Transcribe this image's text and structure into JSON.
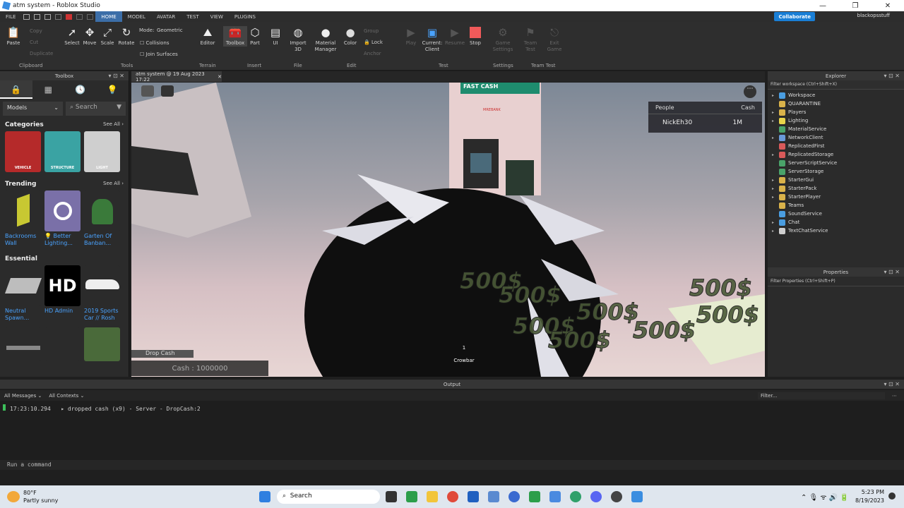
{
  "window": {
    "title": "atm system - Roblox Studio",
    "min": "—",
    "max": "❐",
    "close": "✕"
  },
  "menu": {
    "items": [
      "FILE",
      "HOME",
      "MODEL",
      "AVATAR",
      "TEST",
      "VIEW",
      "PLUGINS"
    ],
    "active": "HOME",
    "collaborate": "Collaborate",
    "user": "blackopsstuff"
  },
  "ribbon": {
    "paste": "Paste",
    "copy": "Copy",
    "cut": "Cut",
    "duplicate": "Duplicate",
    "select": "Select",
    "move": "Move",
    "scale": "Scale",
    "rotate": "Rotate",
    "mode_label": "Mode:",
    "mode_value": "Geometric",
    "collisions": "Collisions",
    "join_surfaces": "Join Surfaces",
    "editor": "Editor",
    "toolbox": "Toolbox",
    "part": "Part",
    "ui": "UI",
    "import3d": "Import 3D",
    "material_manager": "Material Manager",
    "color": "Color",
    "group": "Group",
    "lock": "Lock",
    "anchor": "Anchor",
    "play": "Play",
    "current_client": "Current: Client",
    "resume": "Resume",
    "stop": "Stop",
    "game_settings": "Game Settings",
    "team_test": "Team Test",
    "exit_game": "Exit Game",
    "groups": [
      "Clipboard",
      "Tools",
      "Terrain",
      "Insert",
      "File",
      "Edit",
      "Test",
      "Settings",
      "Team Test"
    ]
  },
  "toolbox": {
    "title": "Toolbox",
    "category_dropdown": "Models",
    "search_placeholder": "Search",
    "categories_title": "Categories",
    "see_all": "See All ›",
    "categories": [
      {
        "label": "VEHICLE",
        "color": "#b52a2a"
      },
      {
        "label": "STRUCTURE",
        "color": "#3aa3a3"
      },
      {
        "label": "LIGHT",
        "color": "#cfcfcf"
      }
    ],
    "trending_title": "Trending",
    "trending": [
      "Backrooms Wall",
      "💡 Better Lighting...",
      "Garten Of Banban..."
    ],
    "essential_title": "Essential",
    "essential": [
      "Neutral Spawn...",
      "HD Admin",
      "2019 Sports Car // Rosh"
    ],
    "hd_text": "HD"
  },
  "document_tab": "atm system @ 19 Aug 2023 17:22",
  "viewport": {
    "atm_sign": "FAST CASH",
    "atm_brand": "MREBANK",
    "leaderboard": {
      "col1": "People",
      "col2": "Cash",
      "player": "NickEh30",
      "cash": "1M"
    },
    "money_text": "500$",
    "drop_cash": "Drop Cash",
    "cash_display": "Cash : 1000000",
    "hotbar_slot": "1",
    "hotbar_item": "Crowbar"
  },
  "explorer": {
    "title": "Explorer",
    "filter": "Filter workspace (Ctrl+Shift+X)",
    "items": [
      {
        "name": "Workspace",
        "arrow": "▸",
        "color": "#4a9de0"
      },
      {
        "name": "QUARANTINE",
        "arrow": "",
        "color": "#d9b24a"
      },
      {
        "name": "Players",
        "arrow": "▸",
        "color": "#d9b24a"
      },
      {
        "name": "Lighting",
        "arrow": "▸",
        "color": "#e8d44a"
      },
      {
        "name": "MaterialService",
        "arrow": "",
        "color": "#4aa36a"
      },
      {
        "name": "NetworkClient",
        "arrow": "▸",
        "color": "#6a9ad9"
      },
      {
        "name": "ReplicatedFirst",
        "arrow": "",
        "color": "#d95a5a"
      },
      {
        "name": "ReplicatedStorage",
        "arrow": "▸",
        "color": "#d95a5a"
      },
      {
        "name": "ServerScriptService",
        "arrow": "",
        "color": "#4aa36a"
      },
      {
        "name": "ServerStorage",
        "arrow": "",
        "color": "#4aa36a"
      },
      {
        "name": "StarterGui",
        "arrow": "▸",
        "color": "#d9b24a"
      },
      {
        "name": "StarterPack",
        "arrow": "▸",
        "color": "#d9b24a"
      },
      {
        "name": "StarterPlayer",
        "arrow": "▸",
        "color": "#d9b24a"
      },
      {
        "name": "Teams",
        "arrow": "",
        "color": "#d9b24a"
      },
      {
        "name": "SoundService",
        "arrow": "",
        "color": "#4a9de0"
      },
      {
        "name": "Chat",
        "arrow": "▸",
        "color": "#4a9de0"
      },
      {
        "name": "TextChatService",
        "arrow": "▸",
        "color": "#cfcfcf"
      }
    ]
  },
  "properties": {
    "title": "Properties",
    "filter": "Filter Properties (Ctrl+Shift+P)"
  },
  "output": {
    "title": "Output",
    "messages_filter": "All Messages",
    "contexts_filter": "All Contexts",
    "filter_placeholder": "Filter...",
    "time": "17:23:10.294",
    "message": "▸ dropped cash (x9)  -  Server - DropCash:2"
  },
  "command_bar": "Run a command",
  "taskbar": {
    "weather_temp": "80°F",
    "weather_desc": "Partly sunny",
    "search": "Search",
    "time": "5:23 PM",
    "date": "8/19/2023"
  }
}
